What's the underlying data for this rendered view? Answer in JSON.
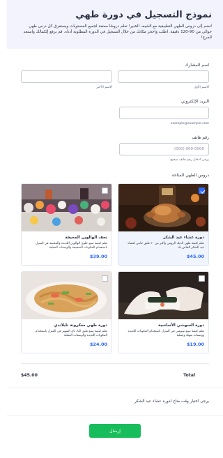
{
  "form": {
    "title": "نموذج التسجيل في دورة طهي",
    "description": "انضم إلى دروس الطهي التطبيقية مع الشيف الخبير! تعلم دروسًا ممتعة لجميع المستويات ويستغرق كل درس طهي حوالي من 90-120 دقيقة. اطلب واحجز مكانك من خلال التسجيل في الدورة المطلوبة أدناه. قم برفع إلكمالك واستعد للمرح!"
  },
  "name": {
    "label": "اسم المشارك",
    "first_sub": "الاسم الأول",
    "last_sub": "الاسم الأخير"
  },
  "email": {
    "label": "البريد الإلكتروني",
    "sub": "example@example.com"
  },
  "phone": {
    "label": "رقم هاتف",
    "placeholder": "(000) 000-0000",
    "sub": "يرجى ادخال رقم هاتف صحيح"
  },
  "classes": {
    "label": "دروس الطهي المتاحة",
    "items": [
      {
        "title": "دورة عشاء عيد الشكر",
        "desc": "تعلم كيفية طهي الديك الرومي وأكثر من ٢٠ طبق جانبي لعشاء عيد الشكر الخاص بك",
        "price": "$45.00",
        "checked": true
      },
      {
        "title": "تحف الهالوين المخيفة",
        "desc": "تعلم كيفية صنع حلوى الهالوين اللذيذة والمخيفة في المنزل باستخدام المكونات الصحيحة والوصفات العملية",
        "price": "$39.00",
        "checked": false
      },
      {
        "title": "دورة السوشي الأساسية",
        "desc": "تعلم كيفية صنع سوشي في المنزل باستخدام المكونات اللذيذة ووصفات سهلة وعملية",
        "price": "$19.00",
        "checked": false
      },
      {
        "title": "دورة طهي معكرونة تايلاندي",
        "desc": "تعلم كيفية صنع طبق الباد تاي الشهير في المنزل باستخدام المكونات اللذيذة والوصفات العملية",
        "price": "$24.00",
        "checked": false
      }
    ]
  },
  "total": {
    "label": "Total",
    "value": "$45.00"
  },
  "note": "يرجى اختيار وقت متاح لدورة عشاء عيد الشكر",
  "submit_label": "إرسال",
  "colors": {
    "accent": "#2e69ff",
    "submit": "#18bd5b",
    "header_bg": "#f3f3fe"
  }
}
